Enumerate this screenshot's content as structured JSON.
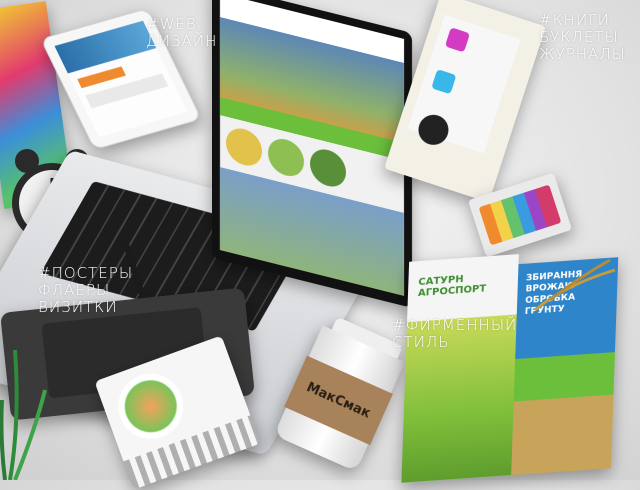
{
  "tags": {
    "web": [
      "#WEB",
      "ДИЗАЙН"
    ],
    "books": [
      "#КНИГИ",
      "БУКЛЕТЫ",
      "ЖУРНАЛЫ"
    ],
    "posters": [
      "#ПОСТЕРЫ",
      "ФЛАЕРЫ",
      "ВИЗИТКИ"
    ],
    "brand": [
      "#ФИРМЕННЫЙ",
      "СТИЛЬ"
    ]
  },
  "cup": {
    "brand": "МакСмак"
  },
  "brochure": {
    "logo_text": "САТУРН АГРОСПОРТ",
    "side_text": [
      "ЗБИРАННЯ",
      "ВРОЖАЮ",
      "ОБРОБКА",
      "ГРУНТУ"
    ]
  },
  "colors": {
    "accent_green": "#6bbf3a",
    "cup_kraft": "#a8825a",
    "laptop_silver": "#c9ccd1"
  }
}
